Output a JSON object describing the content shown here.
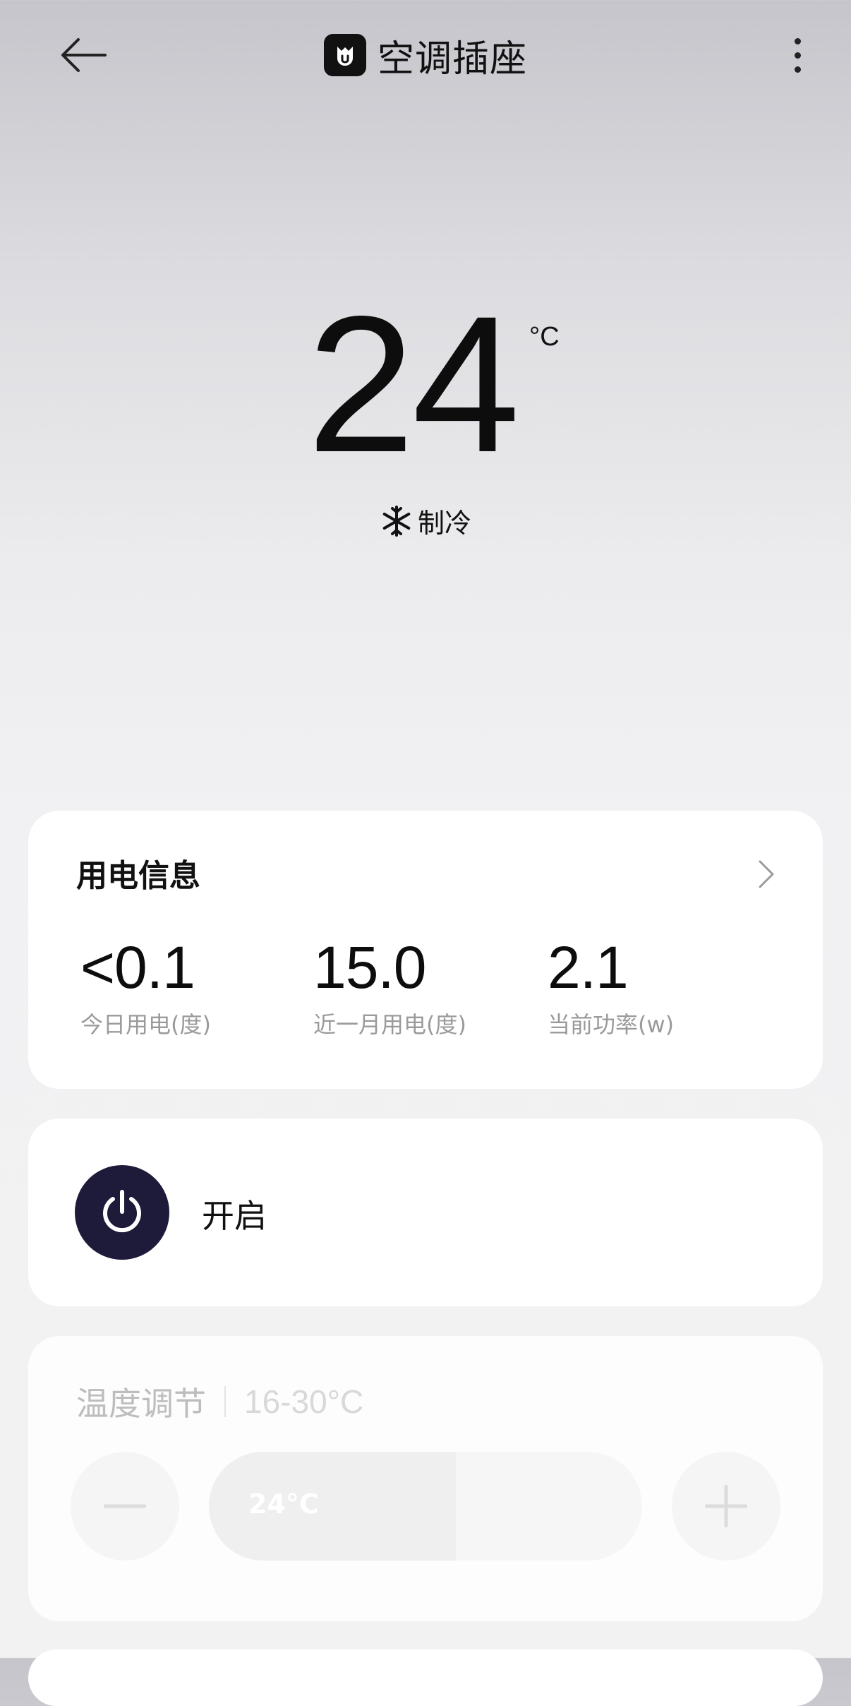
{
  "header": {
    "title": "空调插座",
    "back_icon": "arrow-left-icon",
    "more_icon": "more-vertical-icon",
    "logo_icon": "mi-home-logo-icon"
  },
  "status": {
    "temperature": "24",
    "unit": "°C",
    "mode_icon": "snowflake-icon",
    "mode": "制冷"
  },
  "power_info": {
    "title": "用电信息",
    "chevron_icon": "chevron-right-icon",
    "stats": [
      {
        "value": "<0.1",
        "label": "今日用电(度)"
      },
      {
        "value": "15.0",
        "label": "近一月用电(度)"
      },
      {
        "value": "2.1",
        "label": "当前功率(w)"
      }
    ]
  },
  "switch": {
    "label": "开启",
    "icon": "power-icon",
    "color": "#1e1a3a"
  },
  "temp_control": {
    "title": "温度调节",
    "range": "16-30°C",
    "slider_label": "24°C",
    "slider_fraction": 0.57,
    "minus_icon": "minus-icon",
    "plus_icon": "plus-icon"
  }
}
